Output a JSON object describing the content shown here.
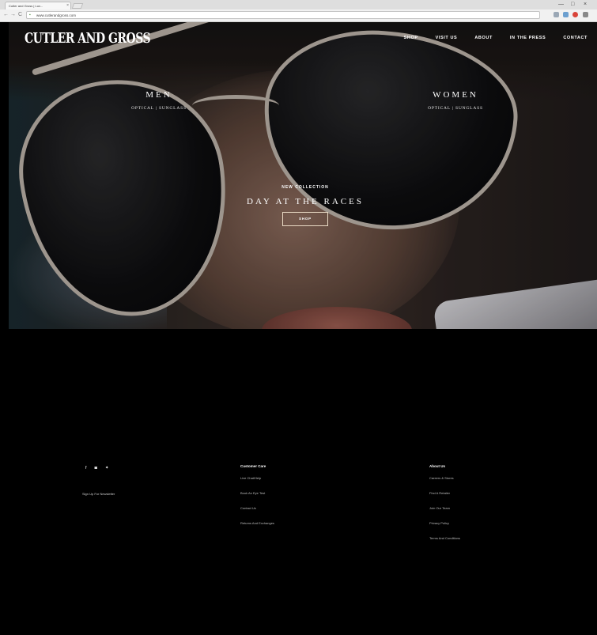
{
  "browser": {
    "tab_title": "Cutler and Gross | Lux...",
    "tab_close": "×",
    "url": "www.cutlerandgross.com",
    "back": "←",
    "forward": "→",
    "reload": "C",
    "minimize": "—",
    "maximize": "□",
    "close": "×"
  },
  "site": {
    "logo": "CUTLER AND GROSS",
    "menu": [
      "SHOP",
      "VISIT US",
      "ABOUT",
      "IN THE PRESS",
      "CONTACT"
    ]
  },
  "hero": {
    "men": {
      "title": "MEN",
      "sub": "OPTICAL | SUNGLASS"
    },
    "women": {
      "title": "WOMEN",
      "sub": "OPTICAL | SUNGLASS"
    },
    "eyebrow": "NEW COLLECTION",
    "collection": "DAY AT THE RACES",
    "button": "SHOP"
  },
  "footer": {
    "social": {
      "facebook": "f",
      "instagram": "◙",
      "twitter": "✦"
    },
    "newsletter": "Sign Up For Newsletter",
    "customer_care": {
      "head": "Customer Care",
      "links": [
        "Live Chat/Help",
        "Book An Eye Test",
        "Contact Us",
        "Returns And Exchanges"
      ]
    },
    "about_us": {
      "head": "About Us",
      "links": [
        "Careers & Stores",
        "Find A Retailer",
        "Join Our Team",
        "Privacy Policy",
        "Terms And Conditions"
      ]
    }
  }
}
